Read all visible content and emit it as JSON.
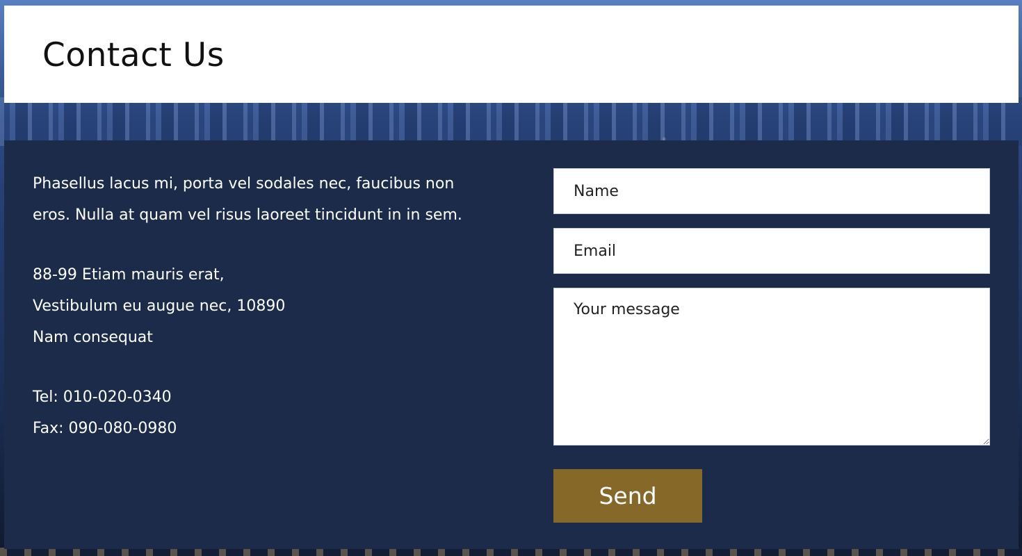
{
  "header": {
    "title": "Contact Us"
  },
  "info": {
    "description": "Phasellus lacus mi, porta vel sodales nec, faucibus non eros. Nulla at quam vel risus laoreet tincidunt in in sem.",
    "address_line1": "88-99 Etiam mauris erat,",
    "address_line2": "Vestibulum eu augue nec, 10890",
    "address_line3": "Nam consequat",
    "tel": "Tel: 010-020-0340",
    "fax": "Fax: 090-080-0980"
  },
  "form": {
    "name_placeholder": "Name",
    "email_placeholder": "Email",
    "message_placeholder": "Your message",
    "send_label": "Send"
  },
  "colors": {
    "panel_background": "#1c2b4a",
    "send_button": "#866829"
  }
}
